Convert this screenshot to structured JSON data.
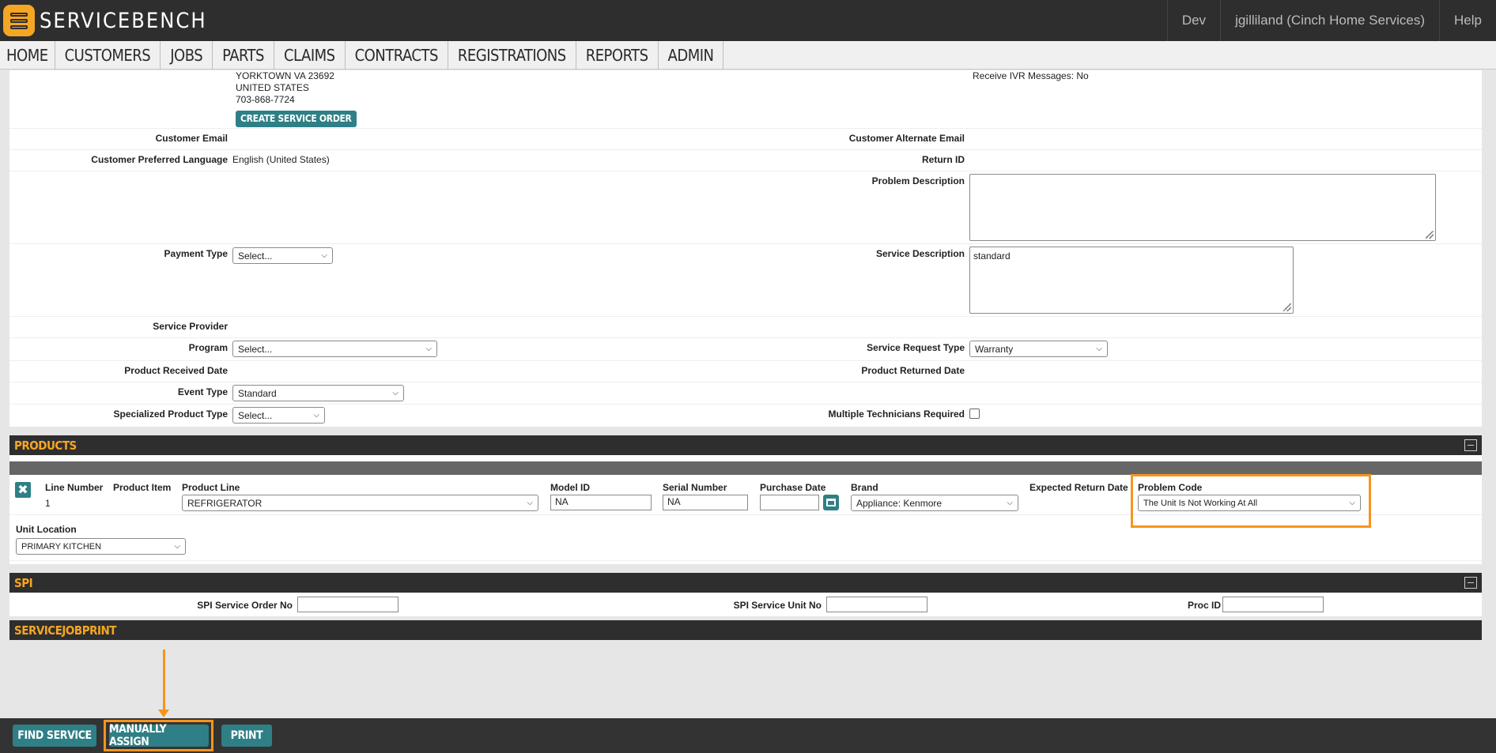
{
  "app": {
    "name": "SERVICEBENCH",
    "env": "Dev",
    "user": "jgilliland (Cinch Home Services)",
    "help": "Help"
  },
  "nav": [
    "HOME",
    "CUSTOMERS",
    "JOBS",
    "PARTS",
    "CLAIMS",
    "CONTRACTS",
    "REGISTRATIONS",
    "REPORTS",
    "ADMIN"
  ],
  "customer": {
    "address_line": "YORKTOWN VA 23692",
    "country": "UNITED STATES",
    "phone": "703-868-7724",
    "create_service_order": "CREATE SERVICE ORDER",
    "ivr_messages": "Receive IVR Messages: No"
  },
  "form": {
    "customer_email_label": "Customer Email",
    "customer_email": "",
    "alt_email_label": "Customer Alternate Email",
    "alt_email": "",
    "pref_lang_label": "Customer Preferred Language",
    "pref_lang": "English (United States)",
    "return_id_label": "Return ID",
    "return_id": "",
    "problem_desc_label": "Problem Description",
    "problem_desc": "",
    "payment_type_label": "Payment Type",
    "payment_type": "Select...",
    "service_desc_label": "Service Description",
    "service_desc": "standard",
    "service_provider_label": "Service Provider",
    "program_label": "Program",
    "program": "Select...",
    "service_request_type_label": "Service Request Type",
    "service_request_type": "Warranty",
    "product_received_label": "Product Received Date",
    "product_returned_label": "Product Returned Date",
    "event_type_label": "Event Type",
    "event_type": "Standard",
    "specialized_product_label": "Specialized Product Type",
    "specialized_product": "Select...",
    "multi_tech_label": "Multiple Technicians Required"
  },
  "products": {
    "title": "PRODUCTS",
    "headers": {
      "line_number": "Line Number",
      "product_item": "Product Item",
      "product_line": "Product Line",
      "model_id": "Model ID",
      "serial_number": "Serial Number",
      "purchase_date": "Purchase Date",
      "brand": "Brand",
      "expected_return": "Expected Return Date",
      "problem_code": "Problem Code",
      "unit_location": "Unit Location"
    },
    "row": {
      "line_number": "1",
      "product_line": "REFRIGERATOR",
      "model_id": "NA",
      "serial_number": "NA",
      "purchase_date": "",
      "brand": "Appliance: Kenmore",
      "problem_code": "The Unit Is Not Working At All",
      "unit_location": "PRIMARY KITCHEN"
    }
  },
  "spi": {
    "title": "SPI",
    "order_no_label": "SPI Service Order No",
    "unit_no_label": "SPI Service Unit No",
    "proc_id_label": "Proc ID"
  },
  "servicejobprint": {
    "title": "SERVICEJOBPRINT"
  },
  "buttons": {
    "find_service": "FIND SERVICE",
    "manually_assign": "MANUALLY ASSIGN",
    "print": "PRINT"
  },
  "colors": {
    "accent": "#f5a623",
    "teal": "#2f7f86",
    "highlight": "#f7941d",
    "dark": "#2e2e2e"
  }
}
